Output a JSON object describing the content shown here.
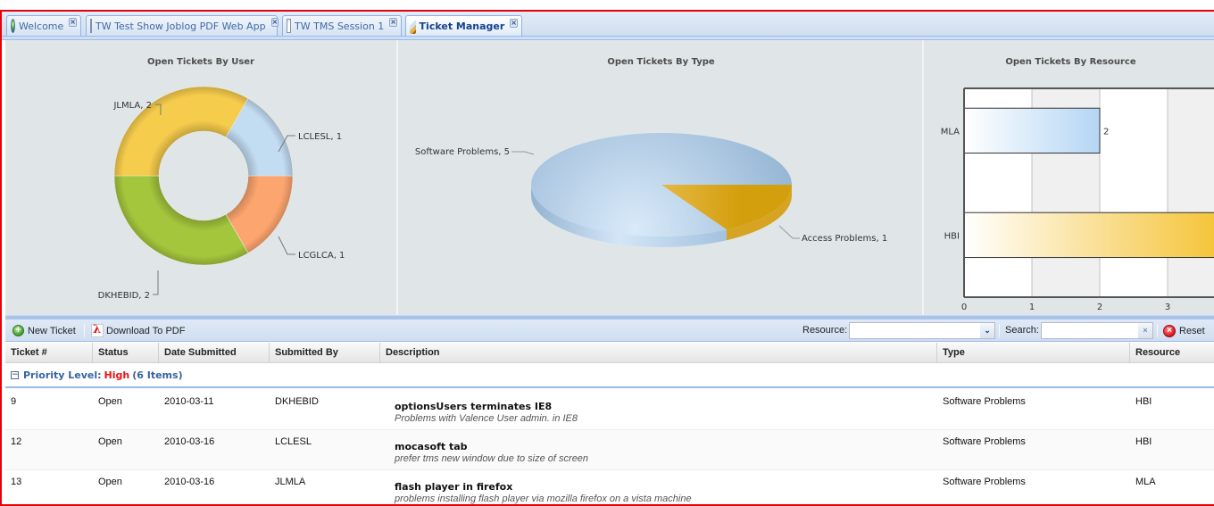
{
  "tabs": [
    {
      "label": "Welcome",
      "icon": "globe-icon",
      "closable": true,
      "active": false
    },
    {
      "label": "TW Test Show Joblog PDF Web App",
      "icon": "page-icon",
      "closable": true,
      "active": false
    },
    {
      "label": "TW TMS Session 1",
      "icon": "page-icon",
      "closable": true,
      "active": false
    },
    {
      "label": "Ticket Manager",
      "icon": "pencil-icon",
      "closable": true,
      "active": true
    }
  ],
  "tab_close_glyph": "×",
  "chart_data": [
    {
      "type": "pie",
      "variant": "donut",
      "title": "Open Tickets By User",
      "categories": [
        "LCLESL",
        "LCGLCA",
        "DKHEBID",
        "JLMLA"
      ],
      "values": [
        1,
        1,
        2,
        2
      ],
      "labels": [
        "LCLESL, 1",
        "LCGLCA, 1",
        "DKHEBID, 2",
        "JLMLA, 2"
      ],
      "colors": [
        "#c2dcf2",
        "#fda56e",
        "#a4c63c",
        "#f6cc4c"
      ]
    },
    {
      "type": "pie",
      "variant": "3d",
      "title": "Open Tickets By Type",
      "categories": [
        "Software Problems",
        "Access Problems"
      ],
      "values": [
        5,
        1
      ],
      "labels": [
        "Software Problems, 5",
        "Access Problems, 1"
      ],
      "colors": [
        "#a6c5e0",
        "#d9a31c"
      ]
    },
    {
      "type": "bar",
      "orientation": "horizontal",
      "title": "Open Tickets By Resource",
      "categories": [
        "MLA",
        "HBI"
      ],
      "values": [
        2,
        4
      ],
      "data_labels": [
        "2",
        ""
      ],
      "xlim": [
        0,
        4
      ],
      "xticks": [
        "0",
        "1",
        "2",
        "3"
      ],
      "grid": true,
      "colors": [
        "#b4d6f4",
        "#f4c02a"
      ]
    }
  ],
  "toolbar": {
    "new_ticket": "New Ticket",
    "download_pdf": "Download To PDF",
    "resource_label": "Resource:",
    "resource_value": "",
    "search_label": "Search:",
    "search_value": "",
    "search_clear_glyph": "×",
    "combo_trigger_glyph": "⌄",
    "reset": "Reset",
    "new_icon_glyph": "+",
    "reset_icon_glyph": "×"
  },
  "grid": {
    "columns": [
      "Ticket #",
      "Status",
      "Date Submitted",
      "Submitted By",
      "Description",
      "Type",
      "Resource"
    ],
    "group": {
      "toggle_glyph": "−",
      "prefix": "Priority Level:",
      "level": "High",
      "count": "(6 Items)"
    },
    "rows": [
      {
        "ticket": "9",
        "status": "Open",
        "date": "2010-03-11",
        "submitted_by": "DKHEBID",
        "title": "optionsUsers terminates IE8",
        "detail": "Problems with Valence User admin. in IE8",
        "type": "Software Problems",
        "resource": "HBI"
      },
      {
        "ticket": "12",
        "status": "Open",
        "date": "2010-03-16",
        "submitted_by": "LCLESL",
        "title": "mocasoft tab",
        "detail": "prefer tms new window due to size of screen",
        "type": "Software Problems",
        "resource": "HBI"
      },
      {
        "ticket": "13",
        "status": "Open",
        "date": "2010-03-16",
        "submitted_by": "JLMLA",
        "title": "flash player in firefox",
        "detail": "problems installing flash player via mozilla firefox on a vista machine",
        "type": "Software Problems",
        "resource": "MLA"
      }
    ]
  }
}
